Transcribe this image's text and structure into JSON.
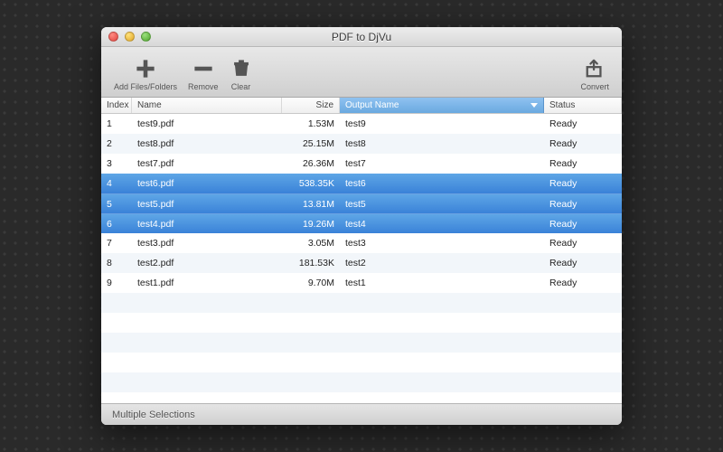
{
  "window": {
    "title": "PDF to DjVu"
  },
  "toolbar": {
    "add": {
      "label": "Add Files/Folders"
    },
    "remove": {
      "label": "Remove"
    },
    "clear": {
      "label": "Clear"
    },
    "convert": {
      "label": "Convert"
    }
  },
  "columns": {
    "index": "Index",
    "name": "Name",
    "size": "Size",
    "output": "Output Name",
    "status": "Status"
  },
  "rows": [
    {
      "index": "1",
      "name": "test9.pdf",
      "size": "1.53M",
      "output": "test9",
      "status": "Ready",
      "selected": false
    },
    {
      "index": "2",
      "name": "test8.pdf",
      "size": "25.15M",
      "output": "test8",
      "status": "Ready",
      "selected": false
    },
    {
      "index": "3",
      "name": "test7.pdf",
      "size": "26.36M",
      "output": "test7",
      "status": "Ready",
      "selected": false
    },
    {
      "index": "4",
      "name": "test6.pdf",
      "size": "538.35K",
      "output": "test6",
      "status": "Ready",
      "selected": true
    },
    {
      "index": "5",
      "name": "test5.pdf",
      "size": "13.81M",
      "output": "test5",
      "status": "Ready",
      "selected": true
    },
    {
      "index": "6",
      "name": "test4.pdf",
      "size": "19.26M",
      "output": "test4",
      "status": "Ready",
      "selected": true
    },
    {
      "index": "7",
      "name": "test3.pdf",
      "size": "3.05M",
      "output": "test3",
      "status": "Ready",
      "selected": false
    },
    {
      "index": "8",
      "name": "test2.pdf",
      "size": "181.53K",
      "output": "test2",
      "status": "Ready",
      "selected": false
    },
    {
      "index": "9",
      "name": "test1.pdf",
      "size": "9.70M",
      "output": "test1",
      "status": "Ready",
      "selected": false
    }
  ],
  "statusbar": {
    "text": "Multiple Selections"
  }
}
